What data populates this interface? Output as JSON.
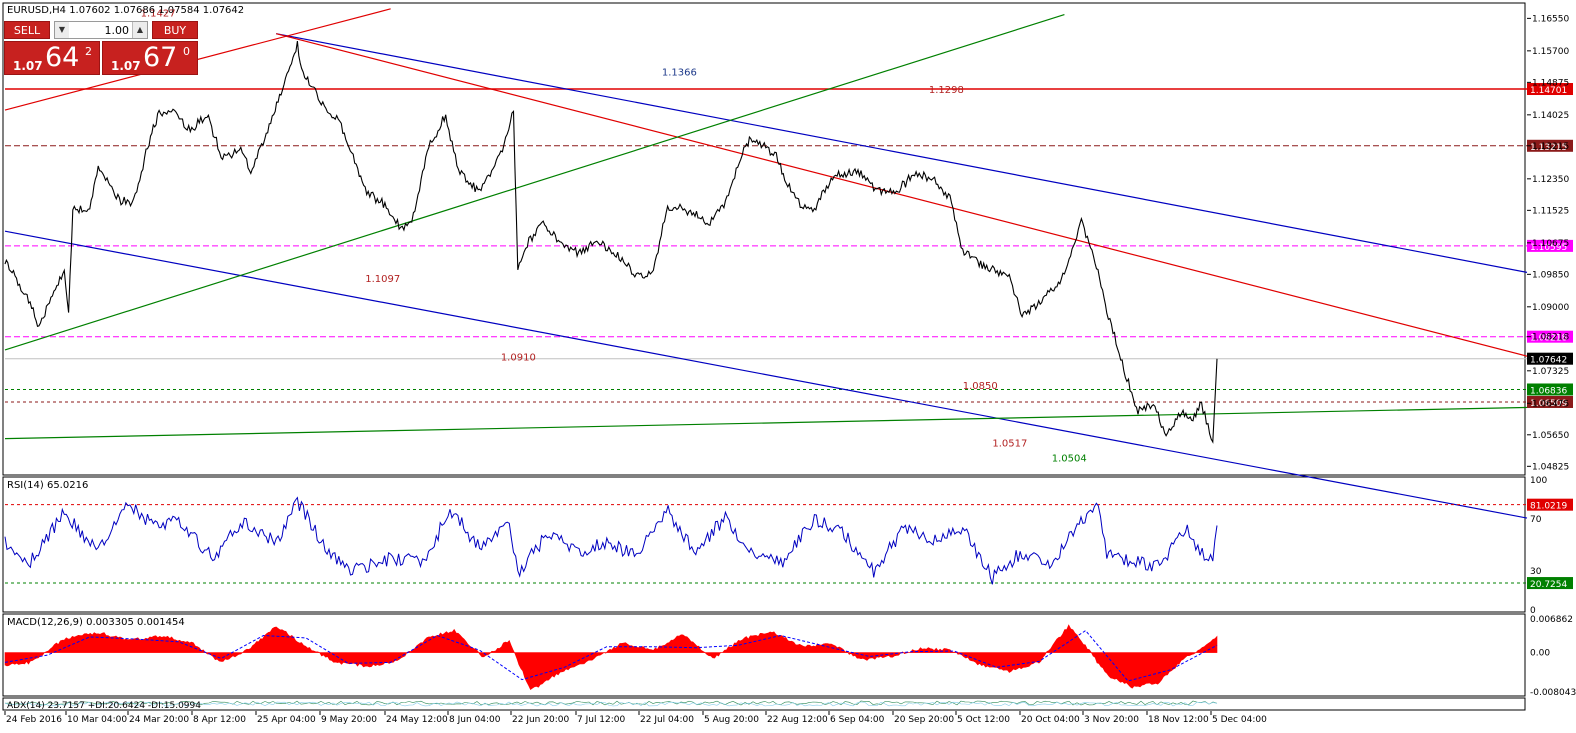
{
  "header": {
    "symbol_info": "EURUSD,H4  1.07602 1.07686 1.07584 1.07642"
  },
  "trade_panel": {
    "sell_label": "SELL",
    "buy_label": "BUY",
    "lot_value": "1.00",
    "sell_price": {
      "prefix": "1.07",
      "big": "64",
      "sup": "2"
    },
    "buy_price": {
      "prefix": "1.07",
      "big": "67",
      "sup": "0"
    }
  },
  "colors": {
    "candles": "#000000",
    "level_red": "#e00000",
    "level_dark": "#8b1a1a",
    "level_magenta": "#ff00ff",
    "level_green": "#008000",
    "trend_blue": "#0000c0",
    "trend_red": "#e00000",
    "trend_green": "#008000",
    "rsi_line": "#0000c0",
    "macd_hist": "#ff0000",
    "macd_signal": "#0000ff",
    "current_price_bg": "#000000"
  },
  "chart_data": [
    {
      "type": "line",
      "title": "EURUSD,H4",
      "ylim": [
        1.0465,
        1.169
      ],
      "xlim_dates": [
        "2016-02-24",
        "2016-12-06"
      ],
      "current_price": "1.07642",
      "y_ticks": [
        "1.16550",
        "1.15700",
        "1.14875",
        "1.14025",
        "1.13215",
        "1.12350",
        "1.11525",
        "1.10675",
        "1.09850",
        "1.09000",
        "1.08218",
        "1.07325",
        "1.06475",
        "1.05650",
        "1.04825"
      ],
      "x_ticks": [
        "24 Feb 2016",
        "10 Mar 04:00",
        "24 Mar 20:00",
        "8 Apr 12:00",
        "25 Apr 04:00",
        "9 May 20:00",
        "24 May 12:00",
        "8 Jun 04:00",
        "22 Jun 20:00",
        "7 Jul 12:00",
        "22 Jul 04:00",
        "5 Aug 20:00",
        "22 Aug 12:00",
        "6 Sep 04:00",
        "20 Sep 20:00",
        "5 Oct 12:00",
        "20 Oct 04:00",
        "3 Nov 20:00",
        "18 Nov 12:00",
        "5 Dec 04:00"
      ],
      "series": [
        {
          "name": "",
          "x": [
            "2016-02-24",
            "2016-02-26",
            "2016-03-02",
            "2016-03-03",
            "2016-03-09",
            "2016-03-10",
            "2016-03-11",
            "2016-03-15",
            "2016-03-17",
            "2016-03-18",
            "2016-03-22",
            "2016-03-25",
            "2016-03-29",
            "2016-03-31",
            "2016-04-04",
            "2016-04-07",
            "2016-04-12",
            "2016-04-15",
            "2016-04-20",
            "2016-04-22",
            "2016-04-26",
            "2016-05-03",
            "2016-05-04",
            "2016-05-09",
            "2016-05-13",
            "2016-05-19",
            "2016-05-24",
            "2016-05-27",
            "2016-05-30",
            "2016-06-03",
            "2016-06-07",
            "2016-06-10",
            "2016-06-15",
            "2016-06-20",
            "2016-06-23",
            "2016-06-24",
            "2016-06-27",
            "2016-06-30",
            "2016-07-05",
            "2016-07-08",
            "2016-07-13",
            "2016-07-19",
            "2016-07-22",
            "2016-07-26",
            "2016-07-29",
            "2016-08-02",
            "2016-08-08",
            "2016-08-12",
            "2016-08-16",
            "2016-08-18",
            "2016-08-24",
            "2016-08-26",
            "2016-08-30",
            "2016-09-02",
            "2016-09-07",
            "2016-09-13",
            "2016-09-16",
            "2016-09-21",
            "2016-09-26",
            "2016-09-30",
            "2016-10-04",
            "2016-10-07",
            "2016-10-13",
            "2016-10-18",
            "2016-10-21",
            "2016-10-26",
            "2016-10-31",
            "2016-11-04",
            "2016-11-09",
            "2016-11-10",
            "2016-11-14",
            "2016-11-17",
            "2016-11-21",
            "2016-11-24",
            "2016-11-28",
            "2016-11-30",
            "2016-12-02",
            "2016-12-05",
            "2016-12-06"
          ],
          "y": [
            1.102,
            1.099,
            1.088,
            1.0845,
            1.1,
            1.088,
            1.115,
            1.116,
            1.127,
            1.125,
            1.118,
            1.117,
            1.133,
            1.14,
            1.142,
            1.136,
            1.14,
            1.129,
            1.131,
            1.125,
            1.136,
            1.159,
            1.152,
            1.143,
            1.138,
            1.121,
            1.116,
            1.111,
            1.112,
            1.132,
            1.14,
            1.126,
            1.12,
            1.13,
            1.141,
            1.1,
            1.108,
            1.112,
            1.106,
            1.104,
            1.107,
            1.102,
            1.098,
            1.099,
            1.115,
            1.116,
            1.112,
            1.117,
            1.13,
            1.134,
            1.13,
            1.123,
            1.116,
            1.116,
            1.125,
            1.125,
            1.121,
            1.12,
            1.125,
            1.123,
            1.119,
            1.105,
            1.1,
            1.098,
            1.088,
            1.092,
            1.098,
            1.113,
            1.095,
            1.089,
            1.074,
            1.063,
            1.064,
            1.057,
            1.063,
            1.06,
            1.065,
            1.055,
            1.0764
          ]
        }
      ],
      "level_labels": [
        "1.14701",
        "1.13215",
        "1.10595",
        "1.08218",
        "1.06836",
        "1.06509"
      ],
      "annotations": [
        {
          "text": "1.1427",
          "color": "#b22222"
        },
        {
          "text": "1.1366",
          "color": "#1e3a8a"
        },
        {
          "text": "1.1298",
          "color": "#b22222"
        },
        {
          "text": "1.1097",
          "color": "#b22222"
        },
        {
          "text": "1.0910",
          "color": "#b22222"
        },
        {
          "text": "1.0850",
          "color": "#b22222"
        },
        {
          "text": "1.0517",
          "color": "#b22222"
        },
        {
          "text": "1.0504",
          "color": "#008000"
        }
      ]
    },
    {
      "type": "line",
      "title": "RSI(14) 65.0216",
      "ylim": [
        0,
        100
      ],
      "y_ticks": [
        "100",
        "70",
        "30",
        "0"
      ],
      "level_labels": [
        "81.0219",
        "20.7254"
      ],
      "series": [
        {
          "name": "",
          "x": [
            "2016-02-24",
            "2016-03-01",
            "2016-03-09",
            "2016-03-17",
            "2016-03-24",
            "2016-03-30",
            "2016-04-05",
            "2016-04-13",
            "2016-04-20",
            "2016-04-28",
            "2016-05-03",
            "2016-05-10",
            "2016-05-16",
            "2016-05-25",
            "2016-06-02",
            "2016-06-08",
            "2016-06-15",
            "2016-06-22",
            "2016-06-24",
            "2016-07-01",
            "2016-07-08",
            "2016-07-15",
            "2016-07-22",
            "2016-07-29",
            "2016-08-05",
            "2016-08-12",
            "2016-08-19",
            "2016-08-26",
            "2016-09-02",
            "2016-09-09",
            "2016-09-16",
            "2016-09-23",
            "2016-09-30",
            "2016-10-07",
            "2016-10-14",
            "2016-10-21",
            "2016-10-28",
            "2016-11-03",
            "2016-11-08",
            "2016-11-10",
            "2016-11-15",
            "2016-11-22",
            "2016-11-29",
            "2016-12-01",
            "2016-12-05",
            "2016-12-06"
          ],
          "y": [
            52,
            38,
            75,
            44,
            82,
            65,
            70,
            40,
            68,
            52,
            84,
            45,
            30,
            40,
            36,
            78,
            48,
            65,
            28,
            58,
            45,
            52,
            42,
            78,
            44,
            72,
            40,
            38,
            70,
            58,
            30,
            62,
            55,
            64,
            24,
            45,
            35,
            66,
            82,
            44,
            38,
            33,
            64,
            46,
            40,
            65
          ]
        }
      ]
    },
    {
      "type": "area",
      "title": "MACD(12,26,9) 0.003305 0.001454",
      "ylim": [
        -0.00804,
        0.00686
      ],
      "y_ticks": [
        "0.006862",
        "0.00",
        "-0.008043"
      ],
      "series": [
        {
          "name": "",
          "x": [
            "2016-02-24",
            "2016-03-01",
            "2016-03-09",
            "2016-03-17",
            "2016-03-24",
            "2016-04-01",
            "2016-04-08",
            "2016-04-15",
            "2016-04-22",
            "2016-04-28",
            "2016-05-04",
            "2016-05-12",
            "2016-05-20",
            "2016-05-27",
            "2016-06-03",
            "2016-06-09",
            "2016-06-16",
            "2016-06-22",
            "2016-06-27",
            "2016-07-04",
            "2016-07-12",
            "2016-07-19",
            "2016-07-26",
            "2016-08-02",
            "2016-08-09",
            "2016-08-16",
            "2016-08-23",
            "2016-08-30",
            "2016-09-06",
            "2016-09-13",
            "2016-09-20",
            "2016-09-27",
            "2016-10-04",
            "2016-10-11",
            "2016-10-18",
            "2016-10-25",
            "2016-11-01",
            "2016-11-04",
            "2016-11-10",
            "2016-11-16",
            "2016-11-22",
            "2016-11-28",
            "2016-12-02",
            "2016-12-06"
          ],
          "y": [
            -0.0025,
            -0.002,
            0.0028,
            0.0041,
            0.0025,
            0.0034,
            0.002,
            -0.002,
            0.001,
            0.0055,
            0.0018,
            -0.002,
            -0.0028,
            -0.0015,
            0.0032,
            0.0045,
            -0.001,
            0.0025,
            -0.0078,
            -0.004,
            -0.0012,
            0.002,
            0.0005,
            0.0038,
            -0.0012,
            0.0028,
            0.0042,
            0.0012,
            0.0018,
            -0.0015,
            -0.0008,
            0.0008,
            0.0005,
            -0.0024,
            -0.0038,
            -0.002,
            0.0055,
            0.0025,
            -0.0045,
            -0.007,
            -0.0062,
            -0.0015,
            0.0008,
            0.0033
          ]
        },
        {
          "name": "",
          "x": [
            "2016-02-24",
            "2016-03-05",
            "2016-03-15",
            "2016-03-25",
            "2016-04-05",
            "2016-04-15",
            "2016-04-25",
            "2016-05-05",
            "2016-05-15",
            "2016-05-25",
            "2016-06-05",
            "2016-06-15",
            "2016-06-25",
            "2016-07-05",
            "2016-07-15",
            "2016-07-25",
            "2016-08-05",
            "2016-08-15",
            "2016-08-25",
            "2016-09-05",
            "2016-09-15",
            "2016-09-25",
            "2016-10-05",
            "2016-10-15",
            "2016-10-25",
            "2016-11-05",
            "2016-11-15",
            "2016-11-25",
            "2016-12-06"
          ],
          "y": [
            -0.002,
            -0.0005,
            0.0032,
            0.0028,
            0.0022,
            -0.0012,
            0.0035,
            0.003,
            -0.0022,
            -0.002,
            0.0035,
            0.0005,
            -0.0055,
            -0.003,
            0.0012,
            0.0012,
            0.001,
            0.0015,
            0.0035,
            0.0012,
            -0.0008,
            0.0002,
            0.0003,
            -0.003,
            -0.0018,
            0.0045,
            -0.0058,
            -0.0035,
            0.0015
          ]
        }
      ]
    },
    {
      "type": "line",
      "title": "ADX(14) 23.7157 +DI:20.6424 -DI:15.0994",
      "series": []
    }
  ]
}
